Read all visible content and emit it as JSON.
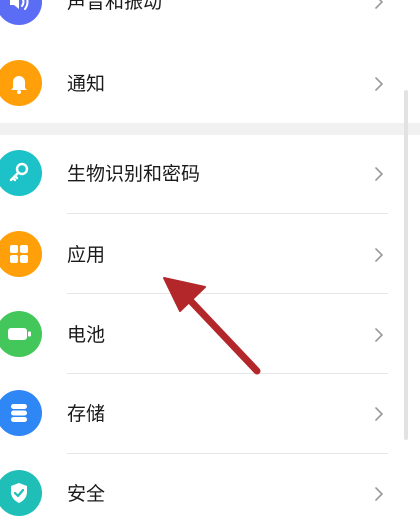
{
  "colors": {
    "sound_icon": "#5b6df5",
    "notify_icon": "#ff9f0a",
    "biometric_icon": "#1cc2c7",
    "apps_icon": "#ff9f0a",
    "battery_icon": "#43c65a",
    "storage_icon": "#2f86f5",
    "security_icon": "#1fbfb8",
    "annotation_arrow": "#b3272b"
  },
  "settings": {
    "items": [
      {
        "label": "声音和振动",
        "icon": "speaker-icon"
      },
      {
        "label": "通知",
        "icon": "bell-icon"
      },
      {
        "label": "生物识别和密码",
        "icon": "key-icon"
      },
      {
        "label": "应用",
        "icon": "apps-grid-icon"
      },
      {
        "label": "电池",
        "icon": "battery-icon"
      },
      {
        "label": "存储",
        "icon": "storage-icon"
      },
      {
        "label": "安全",
        "icon": "shield-check-icon"
      }
    ]
  }
}
